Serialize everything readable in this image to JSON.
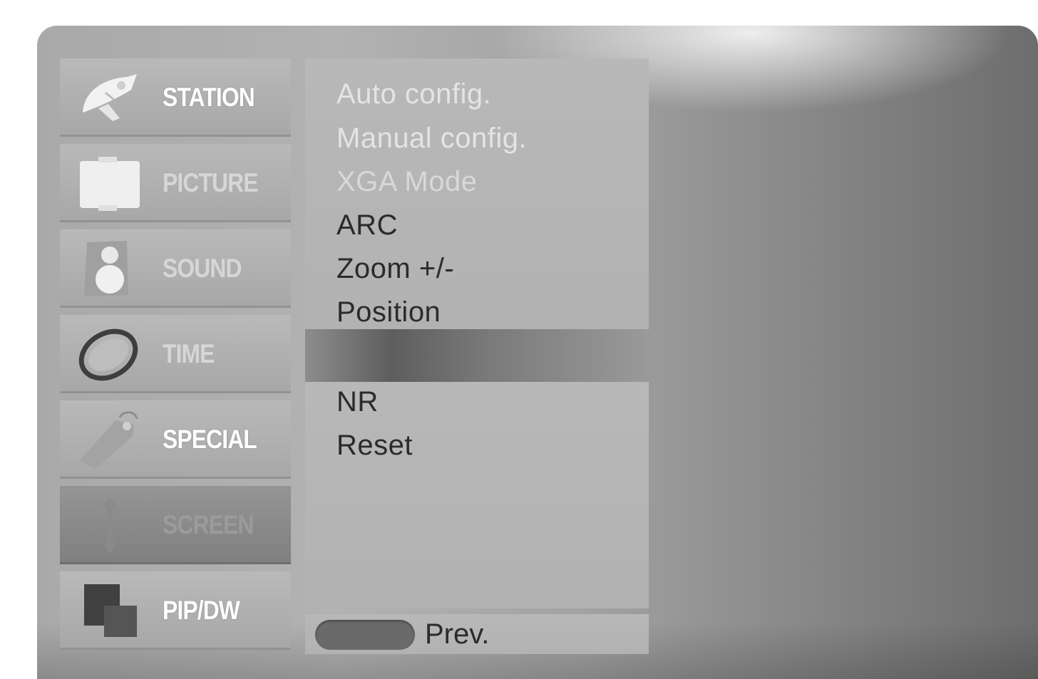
{
  "menu": {
    "categories": [
      {
        "label": "STATION",
        "icon": "satellite-dish-icon"
      },
      {
        "label": "PICTURE",
        "icon": "picture-icon"
      },
      {
        "label": "SOUND",
        "icon": "speaker-icon"
      },
      {
        "label": "TIME",
        "icon": "clock-ring-icon"
      },
      {
        "label": "SPECIAL",
        "icon": "tag-icon"
      },
      {
        "label": "SCREEN",
        "icon": "move-arrows-icon"
      },
      {
        "label": "PIP/DW",
        "icon": "pip-windows-icon"
      }
    ],
    "active_index": 5
  },
  "submenu": {
    "items": [
      {
        "label": "Auto config."
      },
      {
        "label": "Manual config."
      },
      {
        "label": "XGA Mode"
      },
      {
        "label": "ARC"
      },
      {
        "label": "Zoom +/-"
      },
      {
        "label": "Position"
      }
    ],
    "lower_items": [
      {
        "label": "NR"
      },
      {
        "label": "Reset"
      }
    ]
  },
  "footer": {
    "prev_label": "Prev."
  }
}
